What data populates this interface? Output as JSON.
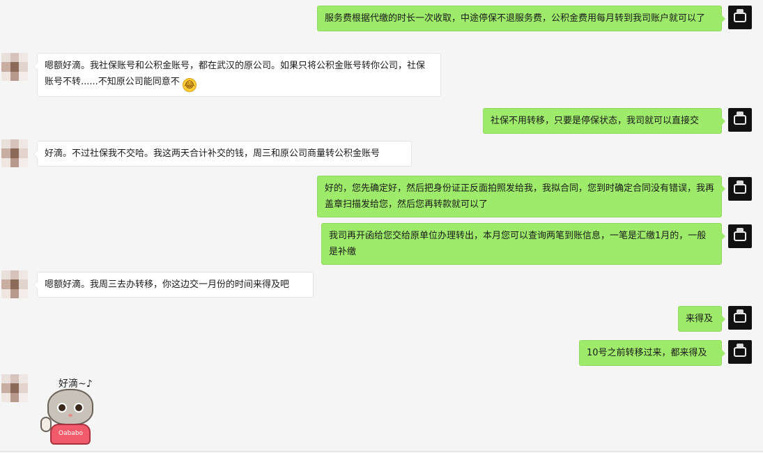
{
  "messages": [
    {
      "side": "out",
      "text": "服务费根据代缴的时长一次收取，中途停保不退服务费，公积金费用每月转到我司账户就可以了"
    },
    {
      "side": "in",
      "text": "嗯额好滴。我社保账号和公积金账号，都在武汉的原公司。如果只将公积金账号转你公司，社保账号不转......不知原公司能同意不",
      "emoji": "😂"
    },
    {
      "side": "out",
      "text": "社保不用转移，只要是停保状态，我司就可以直接交"
    },
    {
      "side": "in",
      "text": "好滴。不过社保我不交哈。我这两天合计补交的钱，周三和原公司商量转公积金账号"
    },
    {
      "side": "out",
      "text": "好的，您先确定好，然后把身份证正反面拍照发给我，我拟合同，您到时确定合同没有错误，我再盖章扫描发给您，然后您再转款就可以了"
    },
    {
      "side": "out",
      "text": "我司再开函给您交给原单位办理转出，本月您可以查询两笔到账信息，一笔是汇缴1月的，一般是补缴"
    },
    {
      "side": "in",
      "text": "嗯额好滴。我周三去办转移，你这边交一月份的时间来得及吧"
    },
    {
      "side": "out",
      "text": "来得及"
    },
    {
      "side": "out",
      "text": "10号之前转移过来，都来得及"
    }
  ],
  "sticker": {
    "caption": "好滴~♪",
    "shirt_text": "Oababo",
    "icon": "cat-waving-sticker"
  },
  "colors": {
    "background": "#f5f5f5",
    "outgoing_bubble": "#9eea6a",
    "incoming_bubble": "#ffffff"
  }
}
